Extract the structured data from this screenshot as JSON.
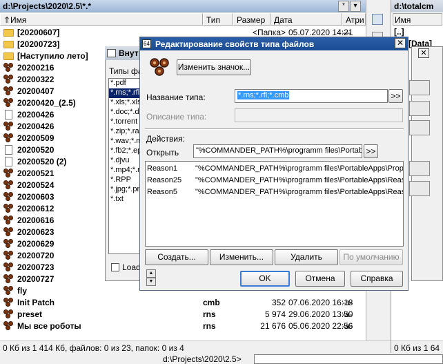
{
  "left_panel": {
    "path": "d:\\Projects\\2020\\2.5\\*.*",
    "path_buttons": [
      "*",
      "▾"
    ],
    "columns": {
      "name": "⇑Имя",
      "ext": "Тип",
      "size": "Размер",
      "date": "Дата",
      "attr": "Атри"
    },
    "files": [
      {
        "icon": "folder",
        "name": "[20200607]",
        "ext": "",
        "size": "<Папка>",
        "date": "05.07.2020 14:21",
        "attr": "—"
      },
      {
        "icon": "folder",
        "name": "[20200723]",
        "ext": "",
        "size": "",
        "date": "",
        "attr": ""
      },
      {
        "icon": "folder",
        "name": "[Наступило лето]",
        "ext": "",
        "size": "",
        "date": "",
        "attr": ""
      },
      {
        "icon": "reason",
        "name": "20200216",
        "ext": "",
        "size": "",
        "date": "",
        "attr": ""
      },
      {
        "icon": "reason",
        "name": "20200322",
        "ext": "",
        "size": "",
        "date": "",
        "attr": ""
      },
      {
        "icon": "reason",
        "name": "20200407",
        "ext": "",
        "size": "",
        "date": "",
        "attr": ""
      },
      {
        "icon": "reason",
        "name": "20200420_(2.5)",
        "ext": "",
        "size": "",
        "date": "",
        "attr": ""
      },
      {
        "icon": "doc",
        "name": "20200426",
        "ext": "",
        "size": "",
        "date": "",
        "attr": ""
      },
      {
        "icon": "reason",
        "name": "20200426",
        "ext": "",
        "size": "",
        "date": "",
        "attr": ""
      },
      {
        "icon": "reason",
        "name": "20200509",
        "ext": "",
        "size": "",
        "date": "",
        "attr": ""
      },
      {
        "icon": "doc",
        "name": "20200520",
        "ext": "",
        "size": "",
        "date": "",
        "attr": ""
      },
      {
        "icon": "doc",
        "name": "20200520 (2)",
        "ext": "",
        "size": "",
        "date": "",
        "attr": ""
      },
      {
        "icon": "reason",
        "name": "20200521",
        "ext": "",
        "size": "",
        "date": "",
        "attr": ""
      },
      {
        "icon": "reason",
        "name": "20200524",
        "ext": "",
        "size": "",
        "date": "",
        "attr": ""
      },
      {
        "icon": "reason",
        "name": "20200603",
        "ext": "",
        "size": "",
        "date": "",
        "attr": ""
      },
      {
        "icon": "reason",
        "name": "20200612",
        "ext": "",
        "size": "",
        "date": "",
        "attr": ""
      },
      {
        "icon": "reason",
        "name": "20200616",
        "ext": "",
        "size": "",
        "date": "",
        "attr": ""
      },
      {
        "icon": "reason",
        "name": "20200623",
        "ext": "",
        "size": "",
        "date": "",
        "attr": ""
      },
      {
        "icon": "reason",
        "name": "20200629",
        "ext": "",
        "size": "",
        "date": "",
        "attr": ""
      },
      {
        "icon": "reason",
        "name": "20200720",
        "ext": "",
        "size": "",
        "date": "",
        "attr": ""
      },
      {
        "icon": "reason",
        "name": "20200723",
        "ext": "",
        "size": "",
        "date": "",
        "attr": ""
      },
      {
        "icon": "reason",
        "name": "20200727",
        "ext": "",
        "size": "",
        "date": "",
        "attr": ""
      },
      {
        "icon": "reason",
        "name": "fly",
        "ext": "",
        "size": "",
        "date": "",
        "attr": ""
      },
      {
        "icon": "reason",
        "name": "Init Patch",
        "ext": "cmb",
        "size": "352",
        "date": "07.06.2020 16:18",
        "attr": "-a-"
      },
      {
        "icon": "reason",
        "name": "preset",
        "ext": "rns",
        "size": "5 974",
        "date": "29.06.2020 13:50",
        "attr": "-a-"
      },
      {
        "icon": "reason",
        "name": "Мы все роботы",
        "ext": "rns",
        "size": "21 676",
        "date": "05.06.2020 22:56",
        "attr": "-a-"
      }
    ],
    "status": "0 Кб из 1 414 Кб, файлов: 0 из 23, папок: 0 из 4"
  },
  "right_panel": {
    "path": "d:\\totalcm",
    "star": "*",
    "column_name": "Имя",
    "row1": "[..]",
    "row2": "[Data]",
    "status": "0 Кб из 1 64"
  },
  "command_line": {
    "label": "d:\\Projects\\2020\\2.5>",
    "value": ""
  },
  "bg_dialog": {
    "title": "Внут",
    "list_label": "Типы фа",
    "types": [
      "*.pdf",
      "*.rns;*.rfl;",
      "*.xls;*.xlsx",
      "*.doc;*.do",
      "*.torrent",
      "*.zip;*.rar",
      "*.wav;*.m",
      "*.fb2;*.ep",
      "*.djvu",
      "*.mp4;*.m",
      "*.RPP",
      "*.jpg;*.pn",
      "*.txt"
    ],
    "selected_index": 1,
    "checkbox_label": "Load"
  },
  "dialog": {
    "title": "Редактирование свойств типа файлов",
    "change_icon_button": "Изменить значок...",
    "type_name_label": "Название типа:",
    "type_name_value": "*.rns;*.rfl;*.cmb",
    "desc_label": "Описание типа:",
    "actions_label": "Действия:",
    "open_label": "Открыть",
    "open_value": "\"%COMMANDER_PATH%\\programm files\\Portable",
    "expand_button": ">>",
    "actions": [
      {
        "name": "Reason1",
        "cmd": "\"%COMMANDER_PATH%\\programm files\\PortableApps\\Propel"
      },
      {
        "name": "Reason25",
        "cmd": "\"%COMMANDER_PATH%\\programm files\\PortableApps\\Reaso"
      },
      {
        "name": "Reason5",
        "cmd": "\"%COMMANDER_PATH%\\programm files\\PortableApps\\Reaso"
      }
    ],
    "buttons": {
      "create": "Создать...",
      "edit": "Изменить...",
      "delete": "Удалить",
      "default": "По умолчанию",
      "ok": "OK",
      "cancel": "Отмена",
      "help": "Справка"
    },
    "title_color": "#1a4c96",
    "selection_color": "#3399ff"
  }
}
